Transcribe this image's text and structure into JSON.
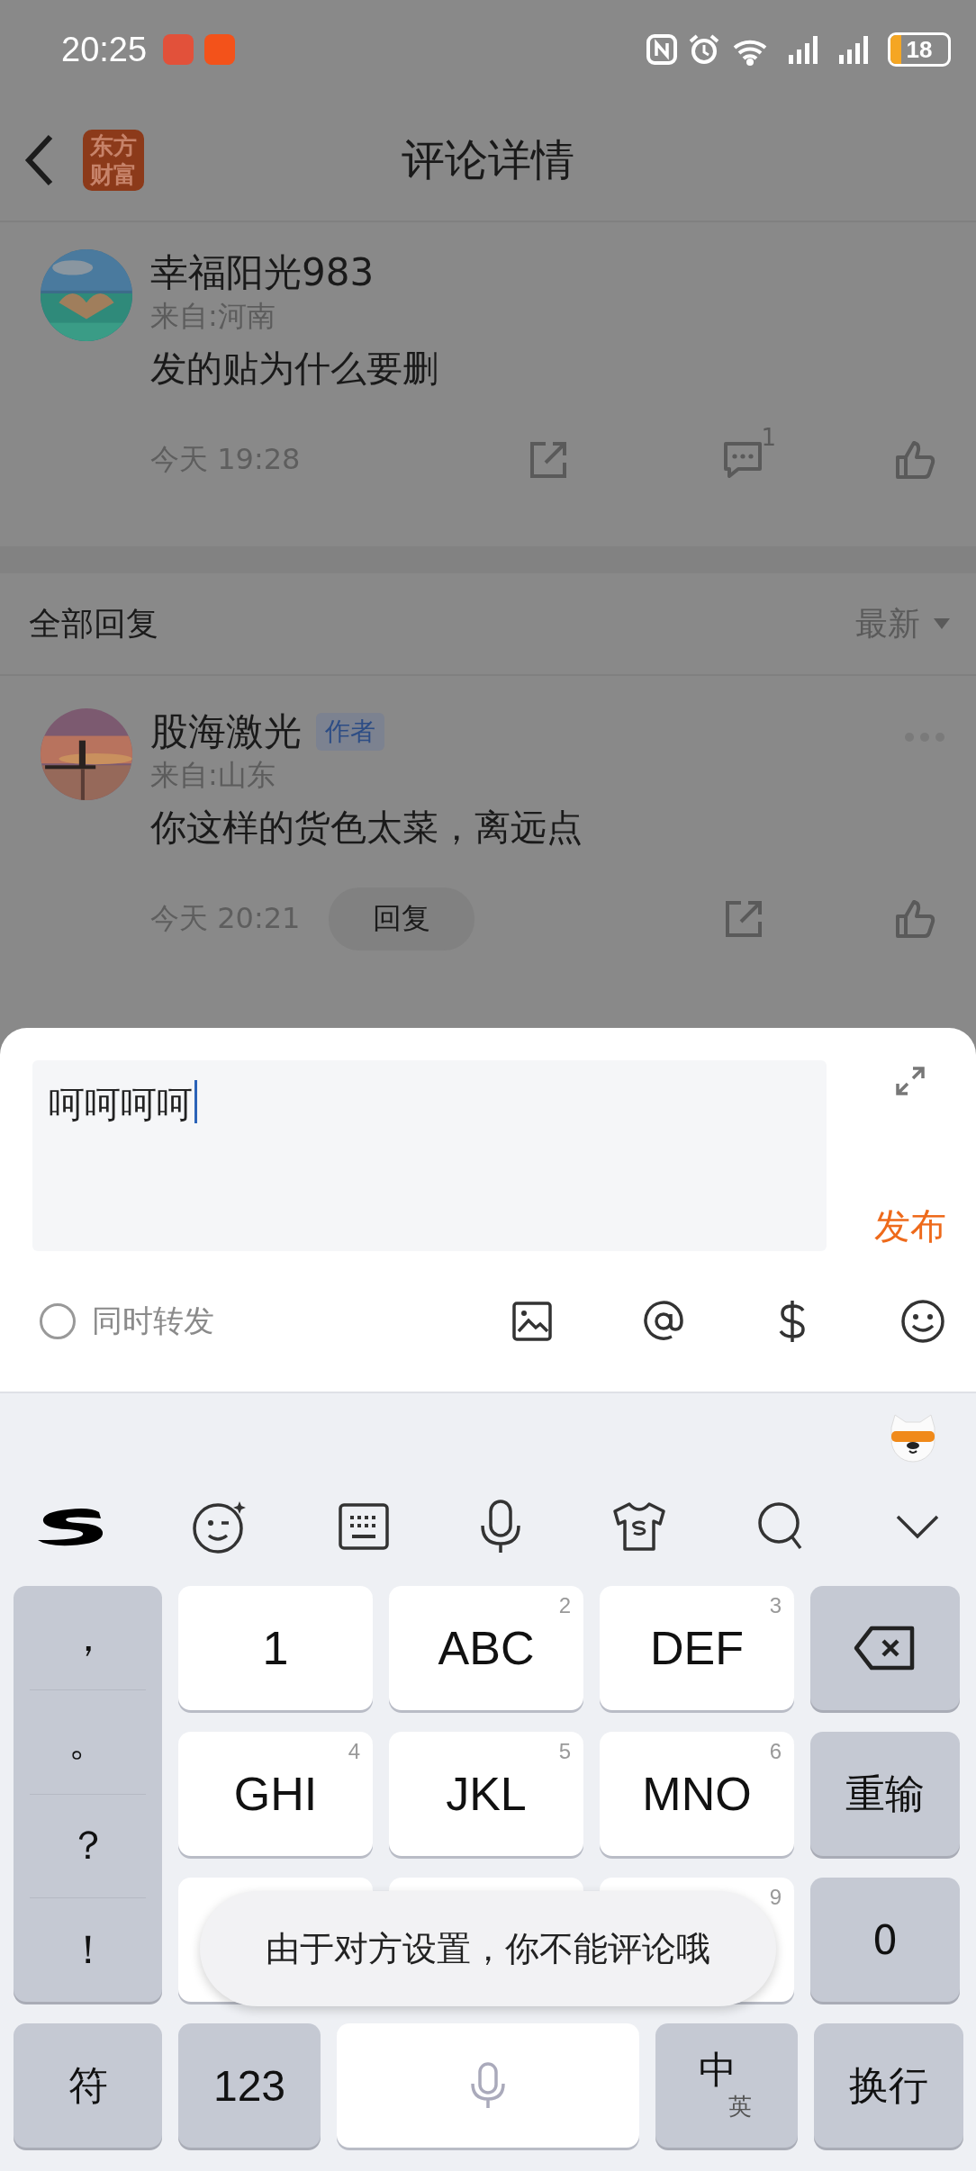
{
  "status_bar": {
    "time": "20:25",
    "battery": "18"
  },
  "header": {
    "title": "评论详情",
    "logo": "东方财富"
  },
  "post": {
    "user": "幸福阳光983",
    "location": "来自:河南",
    "text": "发的贴为什么要删",
    "time": "今天 19:28",
    "comment_count": "1"
  },
  "replies_header": {
    "title": "全部回复",
    "sort": "最新"
  },
  "replies": [
    {
      "user": "股海激光",
      "badge": "作者",
      "location": "来自:山东",
      "text": "你这样的货色太菜，离远点",
      "time": "今天 20:21",
      "reply_button": "回复"
    }
  ],
  "composer": {
    "value": "呵呵呵呵",
    "publish": "发布",
    "repost": {
      "label": "同时转发",
      "checked": false
    }
  },
  "keyboard": {
    "punctuation": [
      "，",
      "。",
      "？",
      "！"
    ],
    "rows": [
      [
        {
          "label": "1"
        },
        {
          "label": "ABC",
          "number": "2"
        },
        {
          "label": "DEF",
          "number": "3"
        }
      ],
      [
        {
          "label": "GHI",
          "number": "4"
        },
        {
          "label": "JKL",
          "number": "5"
        },
        {
          "label": "MNO",
          "number": "6"
        }
      ],
      [
        {},
        {},
        {
          "number": "9"
        }
      ]
    ],
    "side": [
      {
        "kind": "backspace"
      },
      {
        "kind": "text",
        "label": "重输"
      },
      {
        "kind": "text",
        "label": "0"
      }
    ],
    "bottom": {
      "symbols": "符",
      "numbers": "123",
      "lang_main": "中",
      "lang_alt": "英",
      "enter": "换行"
    }
  },
  "toast": "由于对方设置，你不能评论哦"
}
